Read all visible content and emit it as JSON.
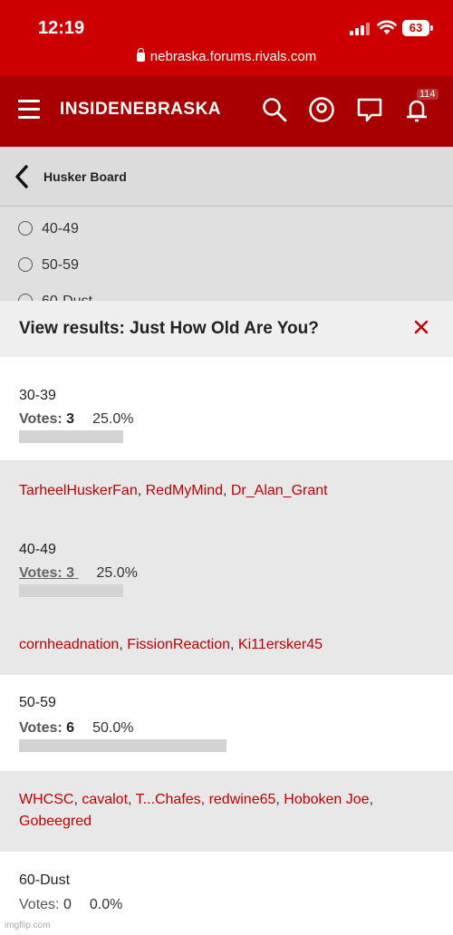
{
  "status": {
    "time": "12:19",
    "battery": "63"
  },
  "browser": {
    "url": "nebraska.forums.rivals.com"
  },
  "header": {
    "brand": "INSIDENEBRASKA",
    "notification_count": "114"
  },
  "breadcrumb": {
    "title": "Husker Board"
  },
  "poll_options_visible": [
    "40-49",
    "50-59",
    "60-Dust"
  ],
  "modal": {
    "title": "View results: Just How Old Are You?",
    "votes_label": "Votes:",
    "results": [
      {
        "range": "30-39",
        "votes": "3",
        "percent": "25.0%",
        "fraction": 0.25,
        "voters": [
          "TarheelHuskerFan",
          "RedMyMind",
          "Dr_Alan_Grant"
        ]
      },
      {
        "range": "40-49",
        "votes": "3",
        "percent": "25.0%",
        "fraction": 0.25,
        "voters": [
          "cornheadnation",
          "FissionReaction",
          "Ki11ersker45"
        ]
      },
      {
        "range": "50-59",
        "votes": "6",
        "percent": "50.0%",
        "fraction": 0.5,
        "voters": [
          "WHCSC",
          "cavalot",
          "T...Chafes",
          "redwine65",
          "Hoboken Joe",
          "Gobeegred"
        ]
      },
      {
        "range": "60-Dust",
        "votes": "0",
        "percent": "0.0%",
        "fraction": 0,
        "voters": []
      }
    ]
  },
  "watermark": "imgflip.com",
  "colors": {
    "status_red": "#cc0000",
    "header_red": "#a80000",
    "link_red": "#c00000"
  }
}
